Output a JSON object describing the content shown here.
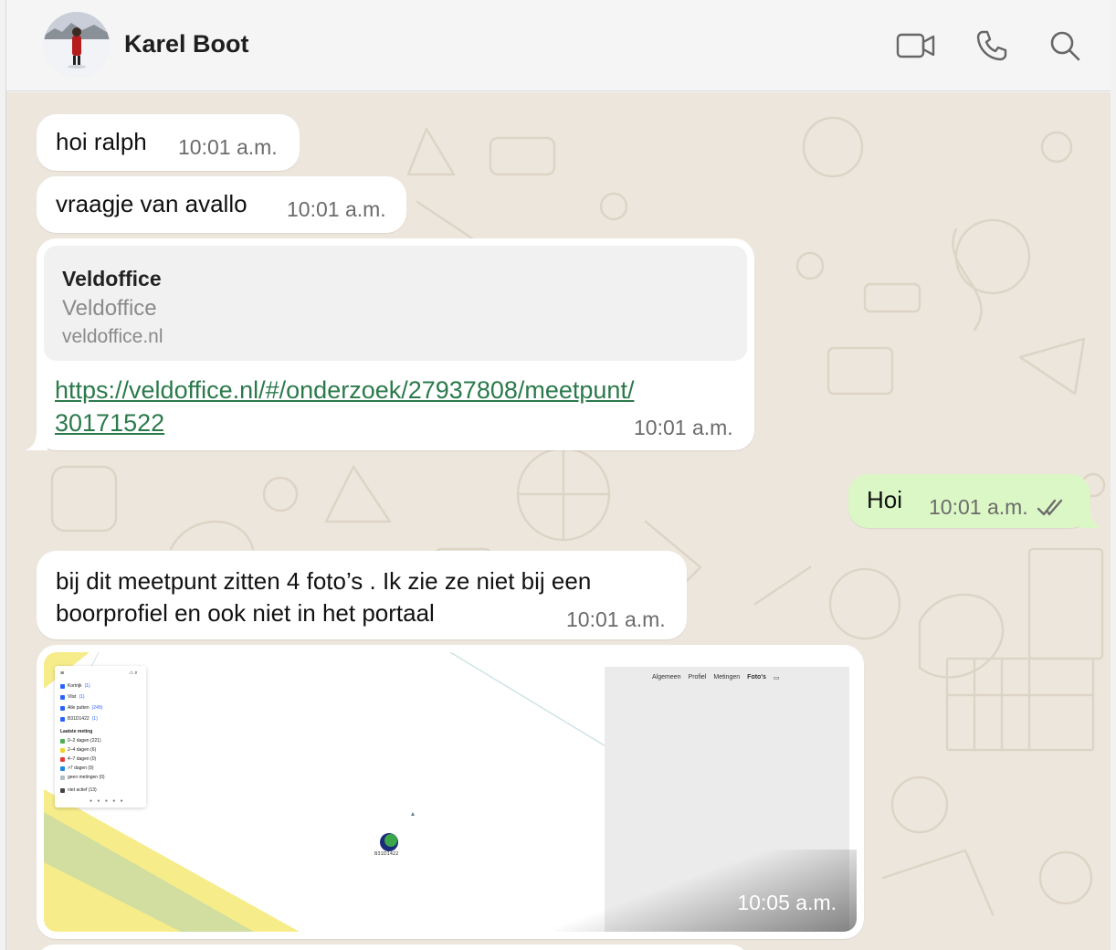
{
  "header": {
    "contact_name": "Karel Boot"
  },
  "messages": [
    {
      "direction": "in",
      "text": "hoi ralph",
      "time": "10:01 a.m."
    },
    {
      "direction": "in",
      "text": "vraagje van avallo",
      "time": "10:01 a.m."
    },
    {
      "direction": "in",
      "type": "link",
      "preview": {
        "title": "Veldoffice",
        "description": "Veldoffice",
        "domain": "veldoffice.nl"
      },
      "url_line1": "https://veldoffice.nl/#/onderzoek/27937808/meetpunt/",
      "url_line2": "30171522",
      "time": "10:01 a.m."
    },
    {
      "direction": "out",
      "text": "Hoi",
      "time": "10:01 a.m.",
      "status": "double-check-read"
    },
    {
      "direction": "in",
      "text_line1": "bij dit meetpunt zitten 4 foto’s . Ik zie ze niet bij een",
      "text_line2": "boorprofiel en ook  niet in het portaal",
      "time": "10:01 a.m."
    },
    {
      "direction": "in",
      "type": "image",
      "time": "10:05 a.m.",
      "image": {
        "layers": [
          {
            "label": "Kortrijk",
            "count": "(1)"
          },
          {
            "label": "Vlist",
            "count": "(1)"
          },
          {
            "label": "Alle putten",
            "count": "(249)"
          },
          {
            "label": "B31D1422",
            "count": "(1)"
          }
        ],
        "legend_title": "Laatste meting",
        "legend": [
          {
            "label": "0–2 dagen (221)",
            "color": "#4caf50"
          },
          {
            "label": "2–4 dagen (6)",
            "color": "#f2d22e"
          },
          {
            "label": "4–7 dagen (0)",
            "color": "#e53935"
          },
          {
            "label": ">7 dagen (9)",
            "color": "#1e88e5"
          },
          {
            "label": "geen metingen (0)",
            "color": "#b0bec5"
          }
        ],
        "inactive": "niet actief (13)",
        "marker_label": "B31D1422",
        "tabs": [
          "Algemeen",
          "Profiel",
          "Metingen",
          "Foto's"
        ]
      }
    }
  ],
  "icons": [
    "video-call-icon",
    "voice-call-icon",
    "search-icon",
    "double-check-icon"
  ],
  "colors": {
    "chat_background": "#ede6dc",
    "incoming_bubble": "#ffffff",
    "outgoing_bubble": "#dcf7c6",
    "link": "#2b7a4b",
    "read_check": "#6b6b6b"
  }
}
